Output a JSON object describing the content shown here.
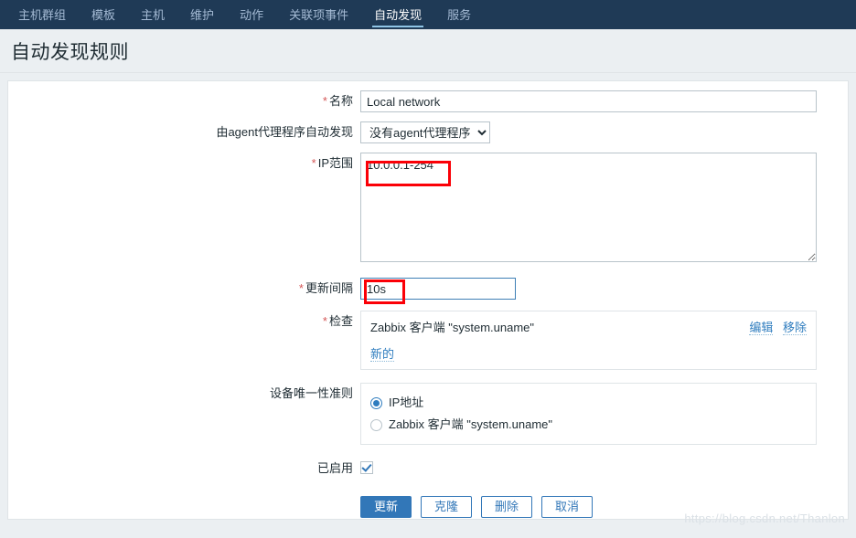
{
  "nav": {
    "items": [
      {
        "label": "主机群组",
        "active": false
      },
      {
        "label": "模板",
        "active": false
      },
      {
        "label": "主机",
        "active": false
      },
      {
        "label": "维护",
        "active": false
      },
      {
        "label": "动作",
        "active": false
      },
      {
        "label": "关联项事件",
        "active": false
      },
      {
        "label": "自动发现",
        "active": true
      },
      {
        "label": "服务",
        "active": false
      }
    ]
  },
  "header": {
    "title": "自动发现规则"
  },
  "form": {
    "name": {
      "label": "名称",
      "required": true,
      "value": "Local network",
      "placeholder": ""
    },
    "proxy": {
      "label": "由agent代理程序自动发现",
      "required": false,
      "selected": "没有agent代理程序",
      "options": [
        "没有agent代理程序"
      ]
    },
    "ip_range": {
      "label": "IP范围",
      "required": true,
      "value": "10.0.0.1-254",
      "placeholder": ""
    },
    "update_interval": {
      "label": "更新间隔",
      "required": true,
      "value": "10s",
      "placeholder": ""
    },
    "checks": {
      "label": "检查",
      "required": true,
      "items": [
        {
          "name": "Zabbix 客户端 \"system.uname\"",
          "edit_label": "编辑",
          "remove_label": "移除"
        }
      ],
      "new_label": "新的"
    },
    "uniqueness": {
      "label": "设备唯一性准则",
      "required": false,
      "options": [
        {
          "label": "IP地址",
          "selected": true
        },
        {
          "label": "Zabbix 客户端 \"system.uname\"",
          "selected": false
        }
      ]
    },
    "enabled": {
      "label": "已启用",
      "required": false,
      "checked": true
    }
  },
  "buttons": {
    "update": "更新",
    "clone": "克隆",
    "delete": "删除",
    "cancel": "取消"
  },
  "watermark": {
    "text": "https://blog.csdn.net/Thanlon"
  },
  "colors": {
    "navbar_bg": "#1f3a56",
    "page_bg": "#ebeff2",
    "accent": "#3277b8",
    "link": "#2f7dbf",
    "required_star": "#d45757",
    "annotation": "#fb0007"
  }
}
